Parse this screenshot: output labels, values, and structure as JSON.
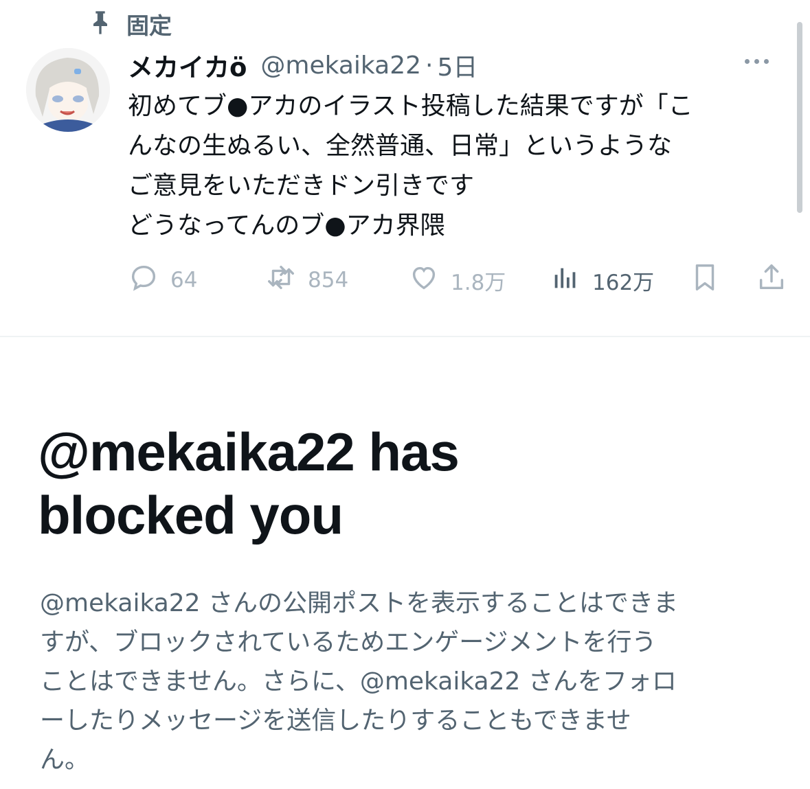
{
  "pinned": {
    "label": "固定",
    "icon": "pin-icon"
  },
  "tweet": {
    "display_name": "メカイカö",
    "handle": "@mekaika22",
    "separator": "·",
    "time": "5日",
    "lines": [
      "初めてブ●アカのイラスト投稿した結果ですが「こ",
      "んなの生ぬるい、全然普通、日常」というような",
      "ご意見をいただきドン引きです",
      "どうなってんのブ●アカ界隈"
    ],
    "actions": {
      "replies": "64",
      "reposts": "854",
      "likes": "1.8万",
      "views": "162万"
    }
  },
  "block_notice": {
    "title_lines": [
      "@mekaika22 has",
      "blocked you"
    ],
    "description_lines": [
      "@mekaika22 さんの公開ポストを表示することはできま",
      "すが、ブロックされているためエンゲージメントを行う",
      "ことはできません。さらに、@mekaika22 さんをフォロ",
      "ーしたりメッセージを送信したりすることもできませ",
      "ん。"
    ]
  },
  "colors": {
    "primary_text": "#0f1419",
    "secondary_text": "#536471",
    "muted_icon": "#aab5bf",
    "divider": "#eff3f4"
  }
}
